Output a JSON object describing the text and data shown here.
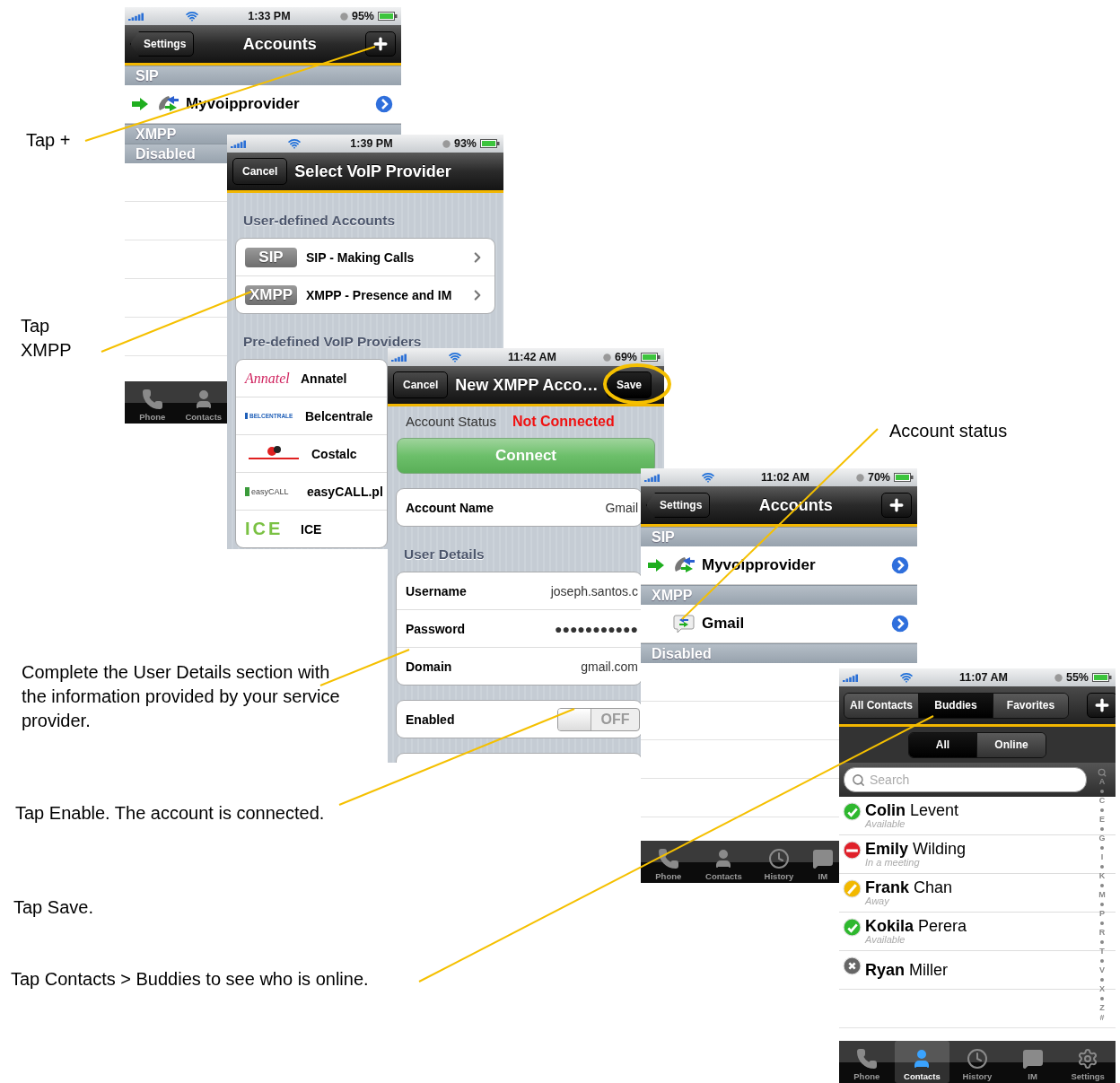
{
  "callouts": [
    {
      "text": "Tap +"
    },
    {
      "text": "Tap XMPP"
    },
    {
      "text": "Account status"
    },
    {
      "text": "Complete the User Details section with the information provided by your service provider."
    },
    {
      "text": "Tap Enable. The account is connected."
    },
    {
      "text": "Tap Save."
    },
    {
      "text": "Tap Contacts > Buddies to see who is online."
    }
  ],
  "screens": [
    {
      "kind": "accounts",
      "status": {
        "time": "1:33 PM",
        "battery": "95%"
      },
      "nav": {
        "back": "Settings",
        "title": "Accounts"
      },
      "sections": [
        {
          "title": "SIP",
          "rows": [
            {
              "kind": "sip",
              "label": "Myvoipprovider",
              "active": true
            }
          ]
        },
        {
          "title": "XMPP"
        },
        {
          "title": "Disabled"
        }
      ],
      "tabs": [
        {
          "kind": "phone",
          "label": "Phone",
          "selected": false
        },
        {
          "kind": "contacts",
          "label": "Contacts",
          "selected": false
        }
      ]
    },
    {
      "kind": "providers",
      "status": {
        "time": "1:39 PM",
        "battery": "93%"
      },
      "nav": {
        "cancel": "Cancel",
        "title": "Select VoIP Provider"
      },
      "groups": [
        {
          "title": "User-defined Accounts",
          "rows": [
            {
              "kind": "badge",
              "badge": "SIP",
              "label": "SIP - Making Calls"
            },
            {
              "kind": "badge",
              "badge": "XMPP",
              "label": "XMPP - Presence and IM"
            }
          ]
        },
        {
          "title": "Pre-defined VoIP Providers",
          "rows": [
            {
              "kind": "script",
              "logo": "Annatel",
              "label": "Annatel"
            },
            {
              "kind": "boxed",
              "logo": "BELCENTRALE",
              "label": "Belcentrale"
            },
            {
              "kind": "mark",
              "label": "Costalc"
            },
            {
              "kind": "tagged",
              "logo": "easyCALL",
              "label": "easyCALL.pl"
            },
            {
              "kind": "block",
              "logo": "ICE",
              "label": "ICE"
            }
          ]
        }
      ]
    },
    {
      "kind": "new_account",
      "status": {
        "time": "11:42 AM",
        "battery": "69%"
      },
      "nav": {
        "cancel": "Cancel",
        "title": "New XMPP Acco…",
        "save": "Save"
      },
      "account_status": {
        "label": "Account Status",
        "value": "Not Connected"
      },
      "connect": "Connect",
      "account": [
        {
          "label": "Account Name",
          "value": "Gmail"
        }
      ],
      "user_details": {
        "title": "User Details",
        "fields": [
          {
            "label": "Username",
            "value": "joseph.santos.c"
          },
          {
            "label": "Password",
            "value": "●●●●●●●●●●●"
          },
          {
            "label": "Domain",
            "value": "gmail.com"
          }
        ]
      },
      "enabled": {
        "label": "Enabled",
        "on": false,
        "text": "OFF"
      }
    },
    {
      "kind": "accounts",
      "status": {
        "time": "11:02 AM",
        "battery": "70%"
      },
      "nav": {
        "back": "Settings",
        "title": "Accounts"
      },
      "sections": [
        {
          "title": "SIP",
          "rows": [
            {
              "kind": "sip",
              "label": "Myvoipprovider",
              "active": true
            }
          ]
        },
        {
          "title": "XMPP",
          "rows": [
            {
              "kind": "xmpp",
              "label": "Gmail",
              "active": false
            }
          ]
        },
        {
          "title": "Disabled"
        }
      ],
      "tabs": [
        {
          "kind": "phone",
          "label": "Phone",
          "selected": false
        },
        {
          "kind": "contacts",
          "label": "Contacts",
          "selected": false
        },
        {
          "kind": "history",
          "label": "History",
          "selected": false
        },
        {
          "kind": "im",
          "label": "IM",
          "selected": false
        }
      ]
    },
    {
      "kind": "buddies",
      "status": {
        "time": "11:07 AM",
        "battery": "55%"
      },
      "segments": [
        {
          "label": "All Contacts",
          "selected": false
        },
        {
          "label": "Buddies",
          "selected": true
        },
        {
          "label": "Favorites",
          "selected": false
        }
      ],
      "filter": [
        {
          "label": "All",
          "selected": true
        },
        {
          "label": "Online",
          "selected": false
        }
      ],
      "search": {
        "placeholder": "Search"
      },
      "buddies": [
        {
          "kind": "available",
          "name": "**Colin** Levent",
          "status_text": "Available"
        },
        {
          "kind": "busy",
          "name": "**Emily** Wilding",
          "status_text": "In a meeting"
        },
        {
          "kind": "away",
          "name": "**Frank** Chan",
          "status_text": "Away"
        },
        {
          "kind": "available",
          "name": "**Kokila** Perera",
          "status_text": "Available"
        },
        {
          "kind": "offline",
          "name": "**Ryan** Miller"
        }
      ],
      "index": [
        "A",
        "C",
        "E",
        "G",
        "I",
        "K",
        "M",
        "P",
        "R",
        "T",
        "V",
        "X",
        "Z",
        "#"
      ],
      "tabs": [
        {
          "kind": "phone",
          "label": "Phone",
          "selected": false
        },
        {
          "kind": "contacts",
          "label": "Contacts",
          "selected": true
        },
        {
          "kind": "history",
          "label": "History",
          "selected": false
        },
        {
          "kind": "im",
          "label": "IM",
          "selected": false
        },
        {
          "kind": "settings",
          "label": "Settings",
          "selected": false
        }
      ]
    }
  ]
}
